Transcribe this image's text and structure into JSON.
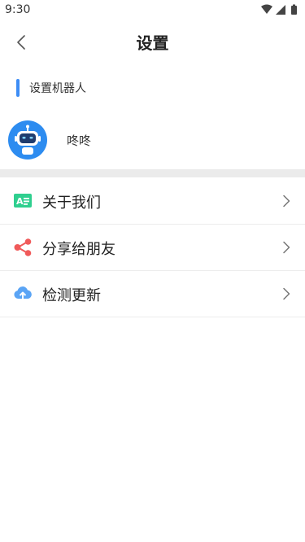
{
  "status_bar": {
    "time": "9:30",
    "icons": [
      "wifi-icon",
      "signal-icon",
      "battery-icon"
    ]
  },
  "header": {
    "title": "设置",
    "back_icon": "chevron-left-icon"
  },
  "section": {
    "title": "设置机器人",
    "accent_color": "#3d8df5"
  },
  "robot": {
    "name": "咚咚",
    "avatar_icon": "robot-icon",
    "avatar_color": "#2d8cf0"
  },
  "menu": {
    "items": [
      {
        "label": "关于我们",
        "icon": "id-card-icon",
        "icon_color": "#2fcf8f"
      },
      {
        "label": "分享给朋友",
        "icon": "share-icon",
        "icon_color": "#f05a5a"
      },
      {
        "label": "检测更新",
        "icon": "cloud-upload-icon",
        "icon_color": "#5aa4f5"
      }
    ]
  },
  "colors": {
    "background": "#ffffff",
    "divider": "#ebebeb",
    "text": "#222222"
  }
}
